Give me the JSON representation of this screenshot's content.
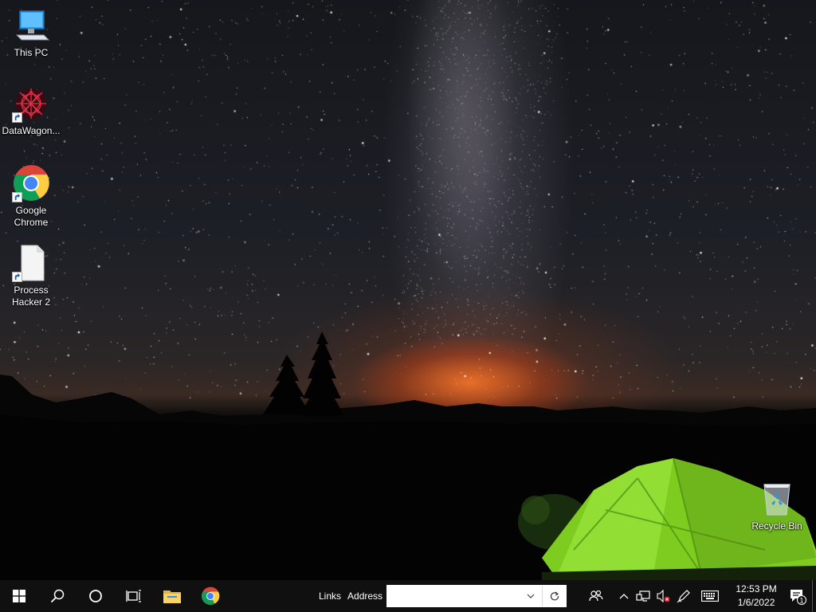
{
  "desktop": {
    "icons": [
      {
        "label": "This PC",
        "icon": "this-pc-icon"
      },
      {
        "label": "DataWagon...",
        "icon": "datawagon-icon"
      },
      {
        "label": "Google Chrome",
        "icon": "chrome-icon"
      },
      {
        "label": "Process Hacker 2",
        "icon": "process-hacker-icon"
      },
      {
        "label": "Recycle Bin",
        "icon": "recycle-bin-icon"
      }
    ]
  },
  "taskbar": {
    "links_label": "Links",
    "address_label": "Address",
    "address_value": "",
    "pinned": [
      "file-explorer-icon",
      "chrome-icon"
    ],
    "clock": {
      "time": "12:53 PM",
      "date": "1/6/2022"
    },
    "notification_count": "1",
    "tray": [
      "people-icon",
      "show-hidden-icons",
      "network-icon",
      "volume-muted-icon",
      "pen-icon",
      "keyboard-icon"
    ]
  },
  "colors": {
    "taskbar_bg": "#101010",
    "tent_green": "#8fdc2a",
    "horizon_orange": "#ff7a2a",
    "windows_logo": "#ffffff"
  }
}
